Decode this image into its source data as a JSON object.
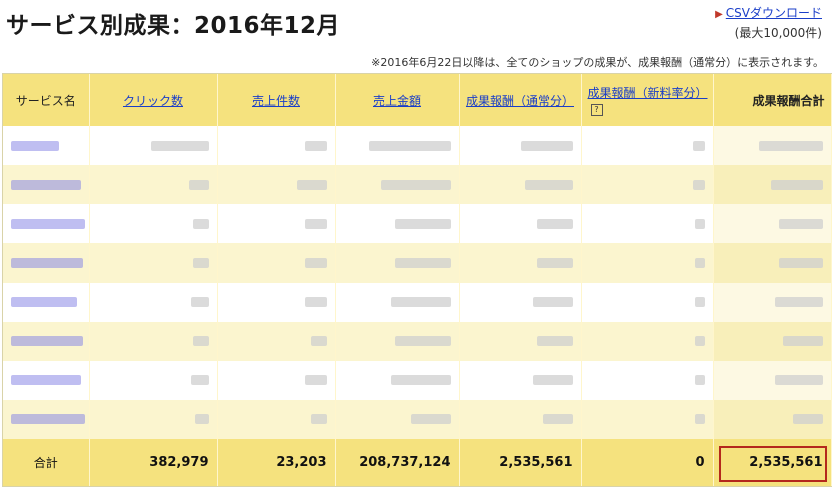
{
  "page": {
    "title": "サービス別成果：2016年12月",
    "csv_link": "CSVダウンロード",
    "csv_note": "(最大10,000件)",
    "notice": "※2016年6月22日以降は、全てのショップの成果が、成果報酬（通常分）に表示されます。"
  },
  "table": {
    "headers": {
      "service": "サービス名",
      "clicks": "クリック数",
      "sales_count": "売上件数",
      "sales_amount": "売上金額",
      "reward_normal": "成果報酬（通常分）",
      "reward_new": "成果報酬（新料率分）",
      "reward_total": "成果報酬合計"
    },
    "help_icon": "?",
    "total": {
      "label": "合計",
      "clicks": "382,979",
      "sales_count": "23,203",
      "sales_amount": "208,737,124",
      "reward_normal": "2,535,561",
      "reward_new": "0",
      "reward_total": "2,535,561"
    }
  }
}
